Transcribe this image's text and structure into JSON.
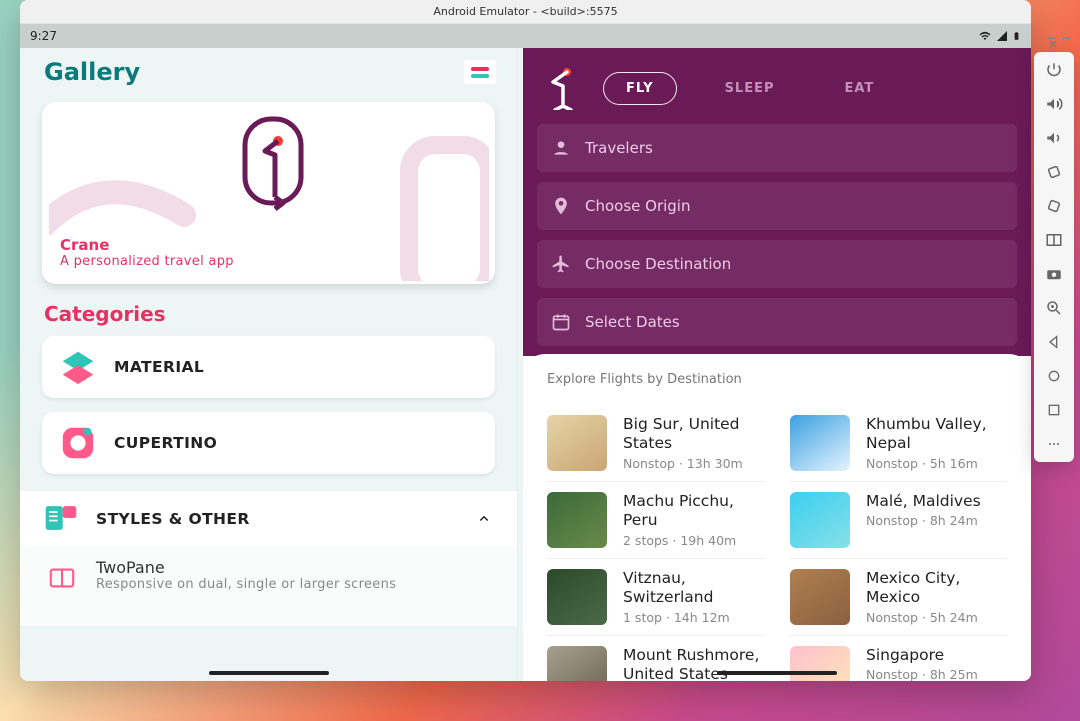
{
  "window_title": "Android Emulator - <build>:5575",
  "status_time": "9:27",
  "gallery": {
    "title": "Gallery",
    "card": {
      "title": "Crane",
      "subtitle": "A personalized travel app"
    },
    "categories_label": "Categories",
    "categories": [
      {
        "label": "MATERIAL"
      },
      {
        "label": "CUPERTINO"
      }
    ],
    "styles_label": "STYLES & OTHER",
    "twopane": {
      "title": "TwoPane",
      "subtitle": "Responsive on dual, single or larger screens"
    }
  },
  "crane": {
    "tabs": [
      {
        "label": "FLY",
        "active": true
      },
      {
        "label": "SLEEP",
        "active": false
      },
      {
        "label": "EAT",
        "active": false
      }
    ],
    "fields": [
      {
        "icon": "person",
        "label": "Travelers"
      },
      {
        "icon": "place",
        "label": "Choose Origin"
      },
      {
        "icon": "plane",
        "label": "Choose Destination"
      },
      {
        "icon": "date",
        "label": "Select Dates"
      }
    ],
    "explore_title": "Explore Flights by Destination",
    "destinations": [
      {
        "name": "Big Sur, United States",
        "meta": "Nonstop · 13h 30m",
        "thumb": "th1"
      },
      {
        "name": "Khumbu Valley, Nepal",
        "meta": "Nonstop · 5h 16m",
        "thumb": "th5"
      },
      {
        "name": "Machu Picchu, Peru",
        "meta": "2 stops · 19h 40m",
        "thumb": "th2"
      },
      {
        "name": "Malé, Maldives",
        "meta": "Nonstop · 8h 24m",
        "thumb": "th6"
      },
      {
        "name": "Vitznau, Switzerland",
        "meta": "1 stop · 14h 12m",
        "thumb": "th3"
      },
      {
        "name": "Mexico City, Mexico",
        "meta": "Nonstop · 5h 24m",
        "thumb": "th7"
      },
      {
        "name": "Mount Rushmore, United States",
        "meta": "",
        "thumb": "th4"
      },
      {
        "name": "Singapore",
        "meta": "Nonstop · 8h 25m",
        "thumb": "th8"
      }
    ]
  },
  "sidepanel": [
    "power",
    "volume-up",
    "volume-down",
    "rotate-left",
    "rotate-right",
    "screenshot-tool",
    "camera",
    "zoom-in",
    "back",
    "home",
    "overview",
    "more"
  ]
}
